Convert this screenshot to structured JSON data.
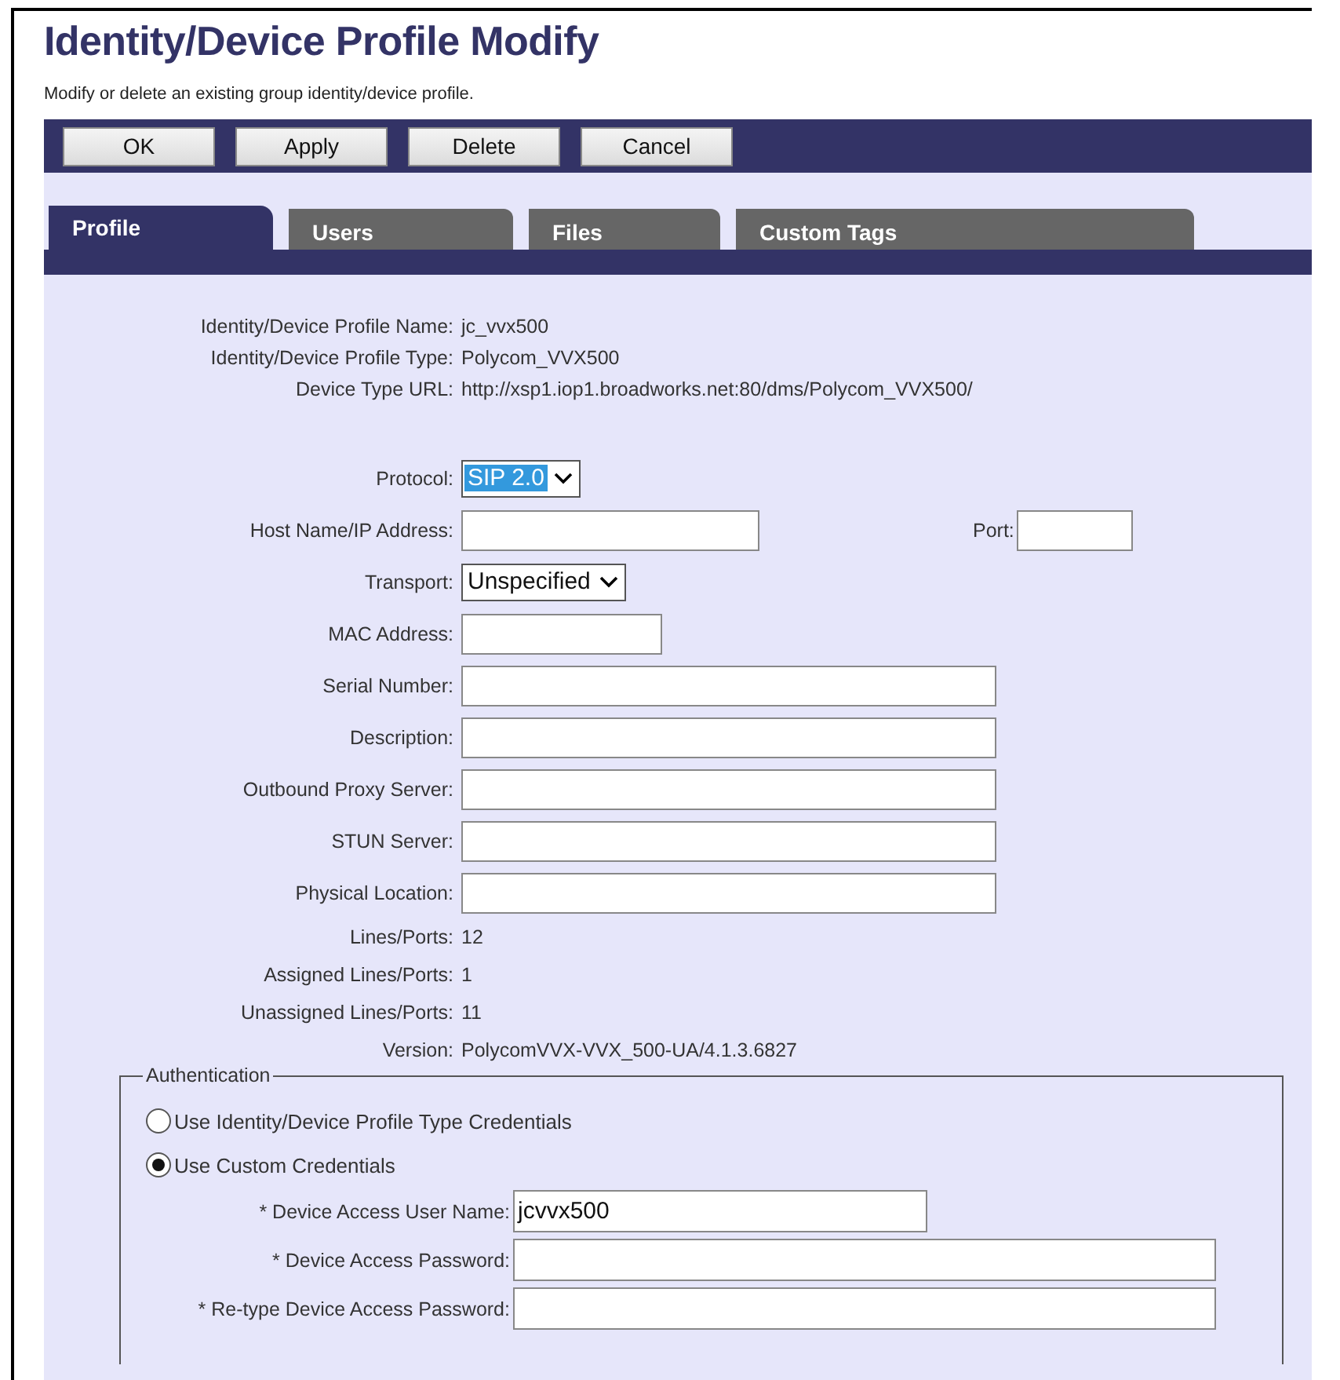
{
  "page": {
    "title": "Identity/Device Profile Modify",
    "description": "Modify or delete an existing group identity/device profile."
  },
  "toolbar": {
    "buttons": [
      "OK",
      "Apply",
      "Delete",
      "Cancel"
    ]
  },
  "tabs": [
    {
      "label": "Profile",
      "selected": true
    },
    {
      "label": "Users",
      "selected": false
    },
    {
      "label": "Files",
      "selected": false
    },
    {
      "label": "Custom Tags",
      "selected": false
    }
  ],
  "info": [
    {
      "label": "Identity/Device Profile Name:",
      "value": "jc_vvx500"
    },
    {
      "label": "Identity/Device Profile Type:",
      "value": "Polycom_VVX500"
    },
    {
      "label": "Device Type URL:",
      "value": "http://xsp1.iop1.broadworks.net:80/dms/Polycom_VVX500/"
    }
  ],
  "form": [
    {
      "kind": "select",
      "label": "Protocol:",
      "value": "SIP 2.0",
      "focused": true
    },
    {
      "kind": "input",
      "label": "Host Name/IP Address:",
      "port": {
        "label": "Port:"
      }
    },
    {
      "kind": "select",
      "label": "Transport:",
      "value": "Unspecified",
      "focused": false
    },
    {
      "kind": "input",
      "label": "MAC Address:"
    },
    {
      "kind": "input",
      "label": "Serial Number:"
    },
    {
      "kind": "input",
      "label": "Description:"
    },
    {
      "kind": "input",
      "label": "Outbound Proxy Server:"
    },
    {
      "kind": "input",
      "label": "STUN Server:"
    },
    {
      "kind": "input",
      "label": "Physical Location:"
    },
    {
      "kind": "text",
      "label": "Lines/Ports:",
      "value": "12"
    },
    {
      "kind": "text",
      "label": "Assigned Lines/Ports:",
      "value": "1"
    },
    {
      "kind": "text",
      "label": "Unassigned Lines/Ports:",
      "value": "11"
    },
    {
      "kind": "text",
      "label": "Version:",
      "value": "PolycomVVX-VVX_500-UA/4.1.3.6827"
    }
  ],
  "authentication": {
    "legend": "Authentication",
    "options": [
      {
        "label": "Use Identity/Device Profile Type Credentials",
        "selected": false
      },
      {
        "label": "Use Custom Credentials",
        "selected": true
      }
    ],
    "fields": [
      {
        "label": "* Device Access User Name:",
        "value": "jcvvx500"
      },
      {
        "label": "* Device Access Password:"
      },
      {
        "label": "* Re-type Device Access Password:"
      }
    ]
  }
}
